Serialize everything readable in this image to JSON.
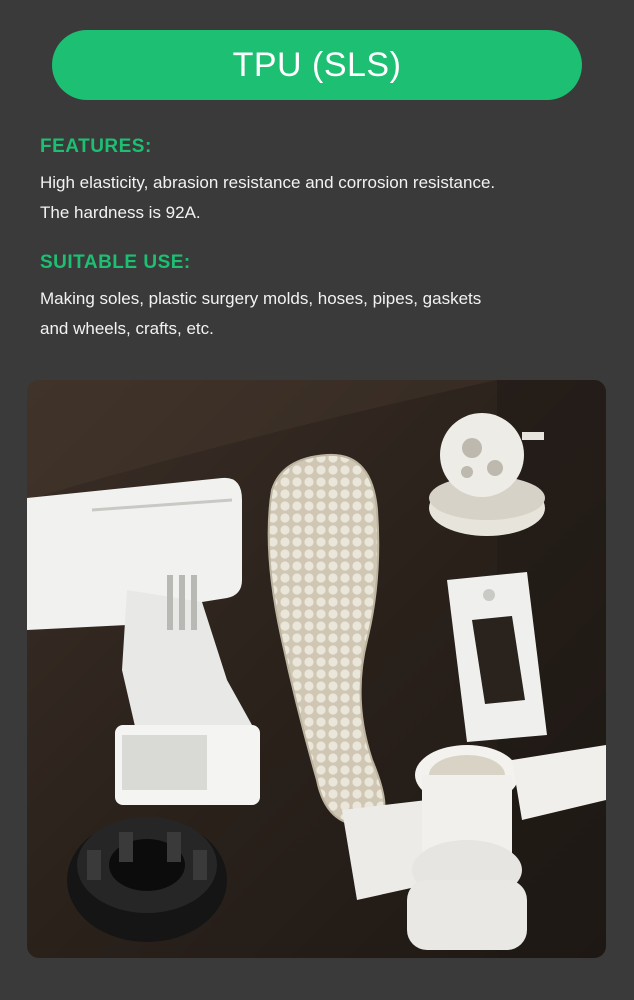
{
  "title": "TPU (SLS)",
  "features": {
    "heading": "FEATURES:",
    "lines": [
      "High elasticity, abrasion resistance and corrosion resistance.",
      "The hardness is 92A."
    ]
  },
  "suitable_use": {
    "heading": "SUITABLE USE:",
    "lines": [
      "Making soles, plastic surgery molds, hoses, pipes, gaskets",
      "and wheels, crafts, etc."
    ]
  },
  "colors": {
    "accent": "#1dbf73",
    "background": "#3a3a3a",
    "text": "#f2f2f2"
  }
}
